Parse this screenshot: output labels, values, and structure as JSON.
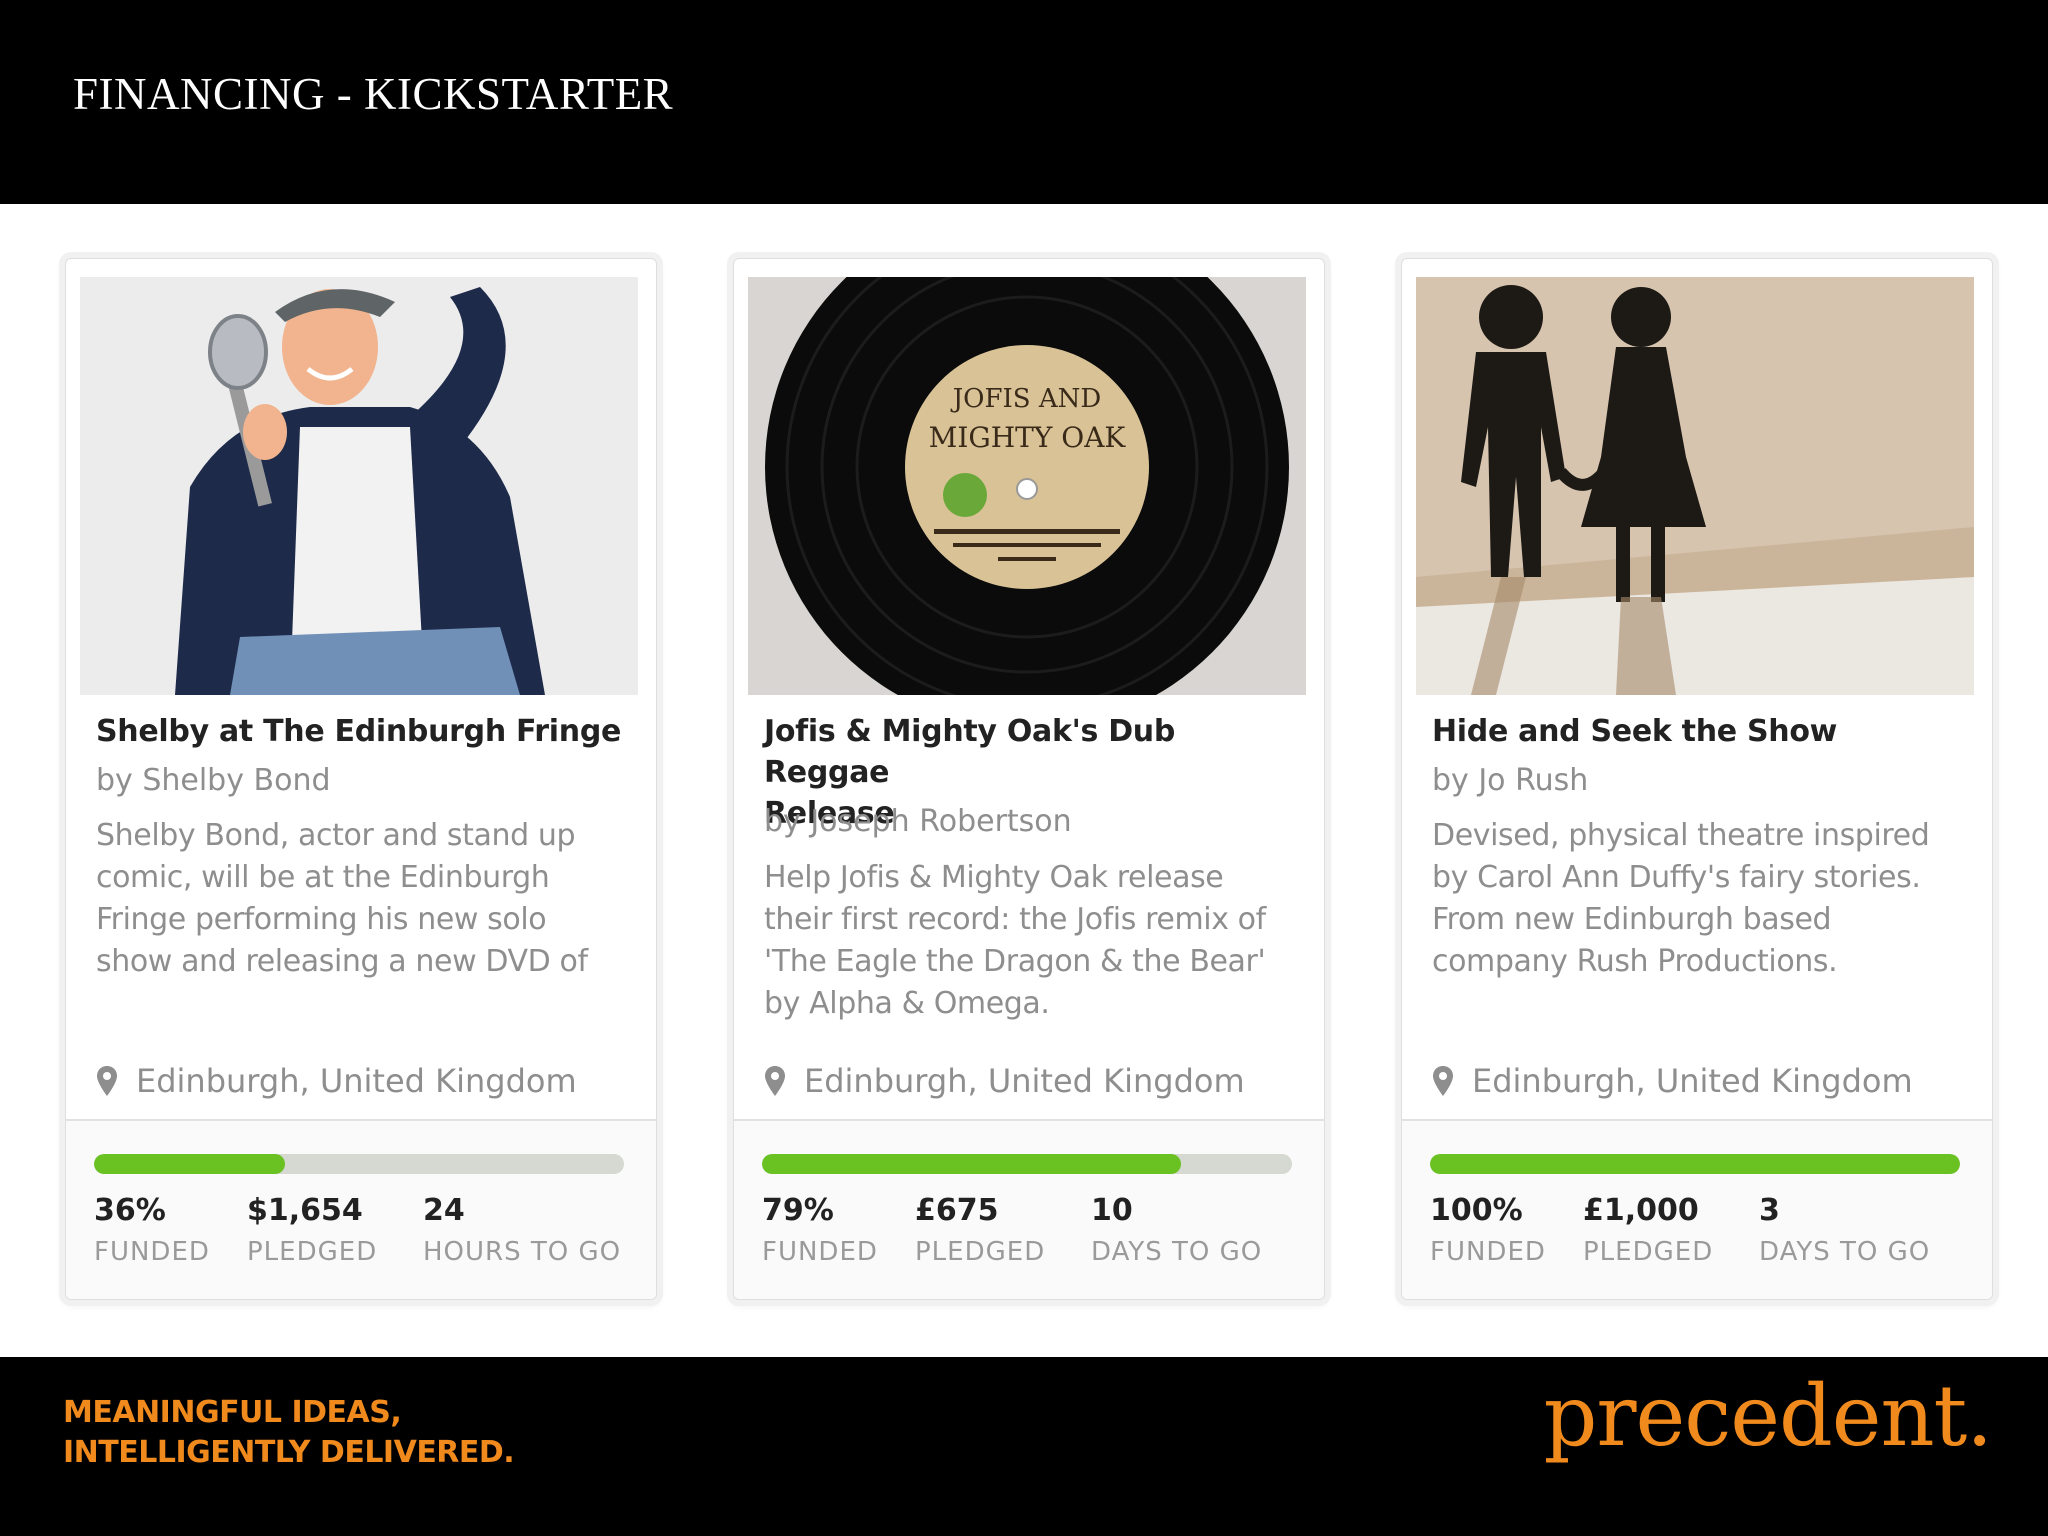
{
  "slide": {
    "title": "FINANCING - KICKSTARTER"
  },
  "footer": {
    "tagline_line1": "MEANINGFUL IDEAS,",
    "tagline_line2": "INTELLIGENTLY DELIVERED.",
    "brand": "precedent."
  },
  "colors": {
    "accent": "#f08a1d",
    "progress": "#6ac122",
    "progress_track": "#d6d8d2"
  },
  "icons": {
    "location": "map-pin-icon"
  },
  "cards": [
    {
      "image": "man-with-microphone-photo",
      "title": "Shelby at The Edinburgh Fringe",
      "author": "by Shelby Bond",
      "description_lines": [
        "Shelby Bond, actor and stand up",
        "comic, will be at the Edinburgh",
        "Fringe performing his new solo",
        "show and releasing a new DVD of"
      ],
      "location": "Edinburgh, United Kingdom",
      "funded_fraction": 0.36,
      "stats": [
        {
          "value": "36%",
          "label": "FUNDED"
        },
        {
          "value": "$1,654",
          "label": "PLEDGED"
        },
        {
          "value": "24",
          "label": "HOURS TO GO"
        }
      ]
    },
    {
      "image": "vinyl-record-photo",
      "record_label_text": [
        "JOFIS AND",
        "MIGHTY OAK"
      ],
      "title_lines": [
        "Jofis & Mighty Oak's Dub Reggae",
        "Release"
      ],
      "author": "by Joseph Robertson",
      "description_lines": [
        "Help Jofis & Mighty Oak release",
        "their first record: the Jofis remix of",
        "'The Eagle the Dragon & the Bear'",
        "by Alpha & Omega."
      ],
      "location": "Edinburgh, United Kingdom",
      "funded_fraction": 0.79,
      "stats": [
        {
          "value": "79%",
          "label": "FUNDED"
        },
        {
          "value": "£675",
          "label": "PLEDGED"
        },
        {
          "value": "10",
          "label": "DAYS TO GO"
        }
      ]
    },
    {
      "image": "paper-silhouettes-holding-hands-photo",
      "title": "Hide and Seek the Show",
      "author": "by Jo Rush",
      "description_lines": [
        "Devised, physical theatre inspired",
        "by Carol Ann Duffy's fairy stories.",
        "From new Edinburgh based",
        "company Rush Productions."
      ],
      "location": "Edinburgh, United Kingdom",
      "funded_fraction": 1.0,
      "stats": [
        {
          "value": "100%",
          "label": "FUNDED"
        },
        {
          "value": "£1,000",
          "label": "PLEDGED"
        },
        {
          "value": "3",
          "label": "DAYS TO GO"
        }
      ]
    }
  ]
}
